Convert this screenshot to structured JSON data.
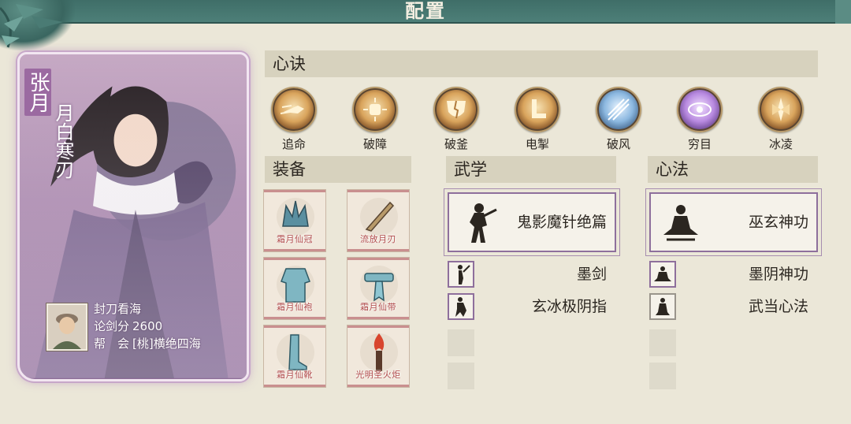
{
  "header": {
    "title": "配置"
  },
  "character": {
    "name": "张月",
    "title": "月白寒刃",
    "player": {
      "nickname": "封刀看海",
      "score_label": "论剑分",
      "score_value": "2600",
      "guild_label": "帮　会",
      "guild_value": "[桃]横绝四海"
    }
  },
  "sections": {
    "xinjue": "心诀",
    "equipment": "装备",
    "wuxue": "武学",
    "xinfa": "心法"
  },
  "skills": [
    {
      "label": "追命",
      "icon": "running-fist-icon",
      "style": "gold"
    },
    {
      "label": "破障",
      "icon": "fist-burst-icon",
      "style": "gold"
    },
    {
      "label": "破釜",
      "icon": "shield-break-icon",
      "style": "gold"
    },
    {
      "label": "电掣",
      "icon": "lightning-boot-icon",
      "style": "gold"
    },
    {
      "label": "破风",
      "icon": "wind-slash-icon",
      "style": "blue"
    },
    {
      "label": "穷目",
      "icon": "eye-icon",
      "style": "purple"
    },
    {
      "label": "冰凌",
      "icon": "ice-crystal-icon",
      "style": "gold"
    }
  ],
  "equipment": [
    {
      "label": "霜月仙冠",
      "icon": "crown-icon"
    },
    {
      "label": "流放月刃",
      "icon": "blade-icon"
    },
    {
      "label": "霜月仙袍",
      "icon": "robe-icon"
    },
    {
      "label": "霜月仙带",
      "icon": "belt-icon"
    },
    {
      "label": "霜月仙靴",
      "icon": "boot-icon"
    },
    {
      "label": "光明圣火炬",
      "icon": "torch-icon"
    }
  ],
  "wuxue": {
    "main": "鬼影魔针绝篇",
    "sub": [
      "墨剑",
      "玄冰极阴指"
    ]
  },
  "xinfa": {
    "main": "巫玄神功",
    "sub": [
      "墨阴神功",
      "武当心法"
    ]
  },
  "colors": {
    "banner": "#4d7f78",
    "card_purple": "#a886ac",
    "slot_border": "#8e6f9c",
    "equip_label": "#b04a4a"
  }
}
